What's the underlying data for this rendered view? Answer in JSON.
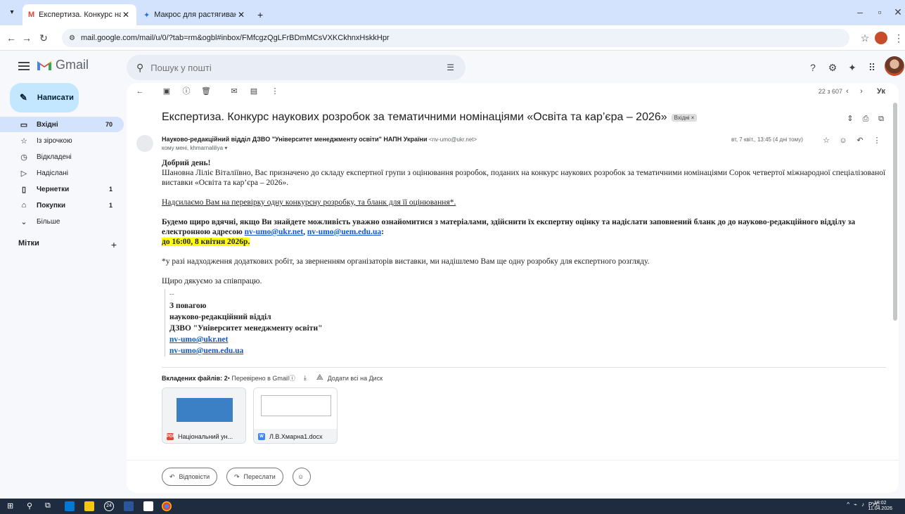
{
  "browser": {
    "tabs": [
      {
        "title": "Експертиза. Конкурс наукови...",
        "favicon": "gmail-icon"
      },
      {
        "title": "Макрос для растягивания скр...",
        "favicon": "sparkle-icon"
      }
    ],
    "url": "mail.google.com/mail/u/0/?tab=rm&ogbl#inbox/FMfcgzQgLFrBDmMCsVXKCkhnxHskkHpr"
  },
  "gmail": {
    "brand": "Gmail",
    "search_placeholder": "Пошук у пошті",
    "compose_label": "Написати",
    "nav": [
      {
        "label": "Вхідні",
        "count": "70",
        "icon": "inbox-icon",
        "active": true
      },
      {
        "label": "Із зірочкою",
        "count": "",
        "icon": "star-icon"
      },
      {
        "label": "Відкладені",
        "count": "",
        "icon": "clock-icon"
      },
      {
        "label": "Надіслані",
        "count": "",
        "icon": "send-icon"
      },
      {
        "label": "Чернетки",
        "count": "1",
        "icon": "draft-icon",
        "bold": true
      },
      {
        "label": "Покупки",
        "count": "1",
        "icon": "shopping-icon",
        "bold": true
      },
      {
        "label": "Більше",
        "count": "",
        "icon": "chevron-down-icon"
      }
    ],
    "labels_title": "Мітки",
    "labels_add": "+"
  },
  "message": {
    "pager": "22 з 607",
    "lang": "Ук",
    "subject": "Експертиза. Конкурс наукових розробок за тематичними номінаціями «Освіта та кар’єра – 2026»",
    "badge": "Вхідні ×",
    "sender_name": "Науково-редакційний відділ ДЗВО \"Університет менеджменту освіти\" НАПН України",
    "sender_email": "<nv-umo@ukr.net>",
    "to": "кому мені, khmarnaliliya ▾",
    "date": "вт, 7 квіт., 13:45 (4 дні тому)",
    "greeting": "Добрий день!",
    "para1": "Шановна Ліліє Віталіївно, Вас призначено до складу експертної групи з оцінювання розробок, поданих на конкурс наукових розробок за тематичними номінаціями Сорок четвертої міжнародної спеціалізованої виставки «Освіта та кар’єра – 2026».",
    "para2": "Надсилаємо Вам на перевірку одну конкурсну розробку, та бланк для її оцінювання*.",
    "para3_start": "Будемо щиро вдячні, якщо Ви знайдете можливість уважно ознайомитися з матеріалами, здійснити їх експертну оцінку та надіслати заповнений бланк до до науково-редакційного відділу за електронною адресою ",
    "link1": "nv-umo@ukr.net",
    "sep": ", ",
    "link2": "nv-umo@uem.edu.ua",
    "colon": ":",
    "deadline": "до 16:00, 8 квітня 2026р.",
    "para4": "*у разі надходження додаткових робіт, за зверненням організаторів виставки, ми надішлемо Вам ще одну розробку для експертного розгляду.",
    "thanks": "Щиро дякуємо за співпрацю.",
    "sig_dash": "--",
    "sig1": "З повагою",
    "sig2": "науково-редакційний відділ",
    "sig3": "ДЗВО \"Університет менеджменту освіти\"",
    "sig4": "nv-umo@ukr.net",
    "sig5": "nv-umo@uem.edu.ua"
  },
  "attachments": {
    "header_count": "Вкладених файлів: 2",
    "checked": " • Перевірено в Gmail ",
    "add_all": "Додати всі на Диск",
    "files": [
      {
        "name": "Національний ун...",
        "type": "PDF",
        "color": "#ea4335"
      },
      {
        "name": "Л.В.Хмарна1.docx",
        "type": "W",
        "color": "#4285f4"
      }
    ]
  },
  "actions": {
    "reply": "Відповісти",
    "forward": "Переслати"
  },
  "taskbar": {
    "badge": "24",
    "lang": "РУС",
    "time": "18:02",
    "date": "11.04.2026"
  }
}
